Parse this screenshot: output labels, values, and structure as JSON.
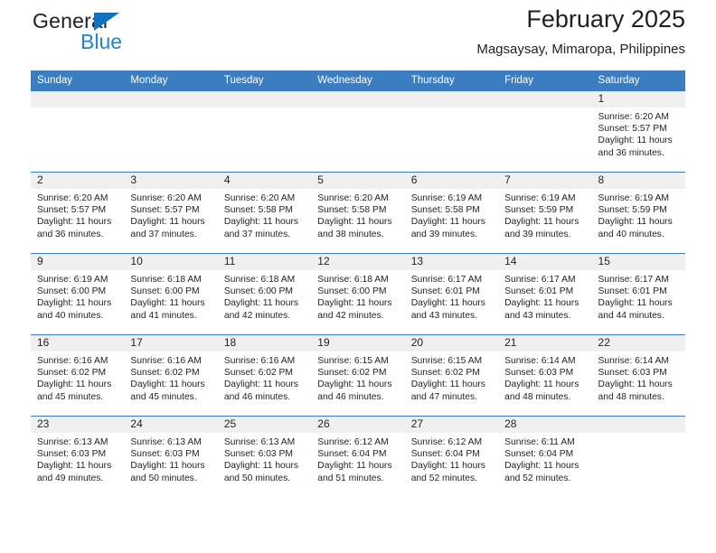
{
  "brand": {
    "name_part1": "General",
    "name_part2": "Blue",
    "triangle_color": "#1271bd",
    "blue_color": "#1f84d6"
  },
  "header": {
    "title": "February 2025",
    "subtitle": "Magsaysay, Mimaropa, Philippines"
  },
  "theme": {
    "header_row_bg": "#3a7dc0",
    "daynum_band_bg": "#f0f0f0",
    "grid_line": "#3a7dc0",
    "text": "#231f20"
  },
  "weekday_headers": [
    "Sunday",
    "Monday",
    "Tuesday",
    "Wednesday",
    "Thursday",
    "Friday",
    "Saturday"
  ],
  "labels": {
    "sunrise_prefix": "Sunrise:",
    "sunset_prefix": "Sunset:",
    "daylight_prefix": "Daylight:"
  },
  "weeks": [
    [
      {
        "empty": true
      },
      {
        "empty": true
      },
      {
        "empty": true
      },
      {
        "empty": true
      },
      {
        "empty": true
      },
      {
        "empty": true
      },
      {
        "day": "1",
        "sunrise": "Sunrise: 6:20 AM",
        "sunset": "Sunset: 5:57 PM",
        "daylight": "Daylight: 11 hours and 36 minutes."
      }
    ],
    [
      {
        "day": "2",
        "sunrise": "Sunrise: 6:20 AM",
        "sunset": "Sunset: 5:57 PM",
        "daylight": "Daylight: 11 hours and 36 minutes."
      },
      {
        "day": "3",
        "sunrise": "Sunrise: 6:20 AM",
        "sunset": "Sunset: 5:57 PM",
        "daylight": "Daylight: 11 hours and 37 minutes."
      },
      {
        "day": "4",
        "sunrise": "Sunrise: 6:20 AM",
        "sunset": "Sunset: 5:58 PM",
        "daylight": "Daylight: 11 hours and 37 minutes."
      },
      {
        "day": "5",
        "sunrise": "Sunrise: 6:20 AM",
        "sunset": "Sunset: 5:58 PM",
        "daylight": "Daylight: 11 hours and 38 minutes."
      },
      {
        "day": "6",
        "sunrise": "Sunrise: 6:19 AM",
        "sunset": "Sunset: 5:58 PM",
        "daylight": "Daylight: 11 hours and 39 minutes."
      },
      {
        "day": "7",
        "sunrise": "Sunrise: 6:19 AM",
        "sunset": "Sunset: 5:59 PM",
        "daylight": "Daylight: 11 hours and 39 minutes."
      },
      {
        "day": "8",
        "sunrise": "Sunrise: 6:19 AM",
        "sunset": "Sunset: 5:59 PM",
        "daylight": "Daylight: 11 hours and 40 minutes."
      }
    ],
    [
      {
        "day": "9",
        "sunrise": "Sunrise: 6:19 AM",
        "sunset": "Sunset: 6:00 PM",
        "daylight": "Daylight: 11 hours and 40 minutes."
      },
      {
        "day": "10",
        "sunrise": "Sunrise: 6:18 AM",
        "sunset": "Sunset: 6:00 PM",
        "daylight": "Daylight: 11 hours and 41 minutes."
      },
      {
        "day": "11",
        "sunrise": "Sunrise: 6:18 AM",
        "sunset": "Sunset: 6:00 PM",
        "daylight": "Daylight: 11 hours and 42 minutes."
      },
      {
        "day": "12",
        "sunrise": "Sunrise: 6:18 AM",
        "sunset": "Sunset: 6:00 PM",
        "daylight": "Daylight: 11 hours and 42 minutes."
      },
      {
        "day": "13",
        "sunrise": "Sunrise: 6:17 AM",
        "sunset": "Sunset: 6:01 PM",
        "daylight": "Daylight: 11 hours and 43 minutes."
      },
      {
        "day": "14",
        "sunrise": "Sunrise: 6:17 AM",
        "sunset": "Sunset: 6:01 PM",
        "daylight": "Daylight: 11 hours and 43 minutes."
      },
      {
        "day": "15",
        "sunrise": "Sunrise: 6:17 AM",
        "sunset": "Sunset: 6:01 PM",
        "daylight": "Daylight: 11 hours and 44 minutes."
      }
    ],
    [
      {
        "day": "16",
        "sunrise": "Sunrise: 6:16 AM",
        "sunset": "Sunset: 6:02 PM",
        "daylight": "Daylight: 11 hours and 45 minutes."
      },
      {
        "day": "17",
        "sunrise": "Sunrise: 6:16 AM",
        "sunset": "Sunset: 6:02 PM",
        "daylight": "Daylight: 11 hours and 45 minutes."
      },
      {
        "day": "18",
        "sunrise": "Sunrise: 6:16 AM",
        "sunset": "Sunset: 6:02 PM",
        "daylight": "Daylight: 11 hours and 46 minutes."
      },
      {
        "day": "19",
        "sunrise": "Sunrise: 6:15 AM",
        "sunset": "Sunset: 6:02 PM",
        "daylight": "Daylight: 11 hours and 46 minutes."
      },
      {
        "day": "20",
        "sunrise": "Sunrise: 6:15 AM",
        "sunset": "Sunset: 6:02 PM",
        "daylight": "Daylight: 11 hours and 47 minutes."
      },
      {
        "day": "21",
        "sunrise": "Sunrise: 6:14 AM",
        "sunset": "Sunset: 6:03 PM",
        "daylight": "Daylight: 11 hours and 48 minutes."
      },
      {
        "day": "22",
        "sunrise": "Sunrise: 6:14 AM",
        "sunset": "Sunset: 6:03 PM",
        "daylight": "Daylight: 11 hours and 48 minutes."
      }
    ],
    [
      {
        "day": "23",
        "sunrise": "Sunrise: 6:13 AM",
        "sunset": "Sunset: 6:03 PM",
        "daylight": "Daylight: 11 hours and 49 minutes."
      },
      {
        "day": "24",
        "sunrise": "Sunrise: 6:13 AM",
        "sunset": "Sunset: 6:03 PM",
        "daylight": "Daylight: 11 hours and 50 minutes."
      },
      {
        "day": "25",
        "sunrise": "Sunrise: 6:13 AM",
        "sunset": "Sunset: 6:03 PM",
        "daylight": "Daylight: 11 hours and 50 minutes."
      },
      {
        "day": "26",
        "sunrise": "Sunrise: 6:12 AM",
        "sunset": "Sunset: 6:04 PM",
        "daylight": "Daylight: 11 hours and 51 minutes."
      },
      {
        "day": "27",
        "sunrise": "Sunrise: 6:12 AM",
        "sunset": "Sunset: 6:04 PM",
        "daylight": "Daylight: 11 hours and 52 minutes."
      },
      {
        "day": "28",
        "sunrise": "Sunrise: 6:11 AM",
        "sunset": "Sunset: 6:04 PM",
        "daylight": "Daylight: 11 hours and 52 minutes."
      },
      {
        "empty": true
      }
    ]
  ]
}
